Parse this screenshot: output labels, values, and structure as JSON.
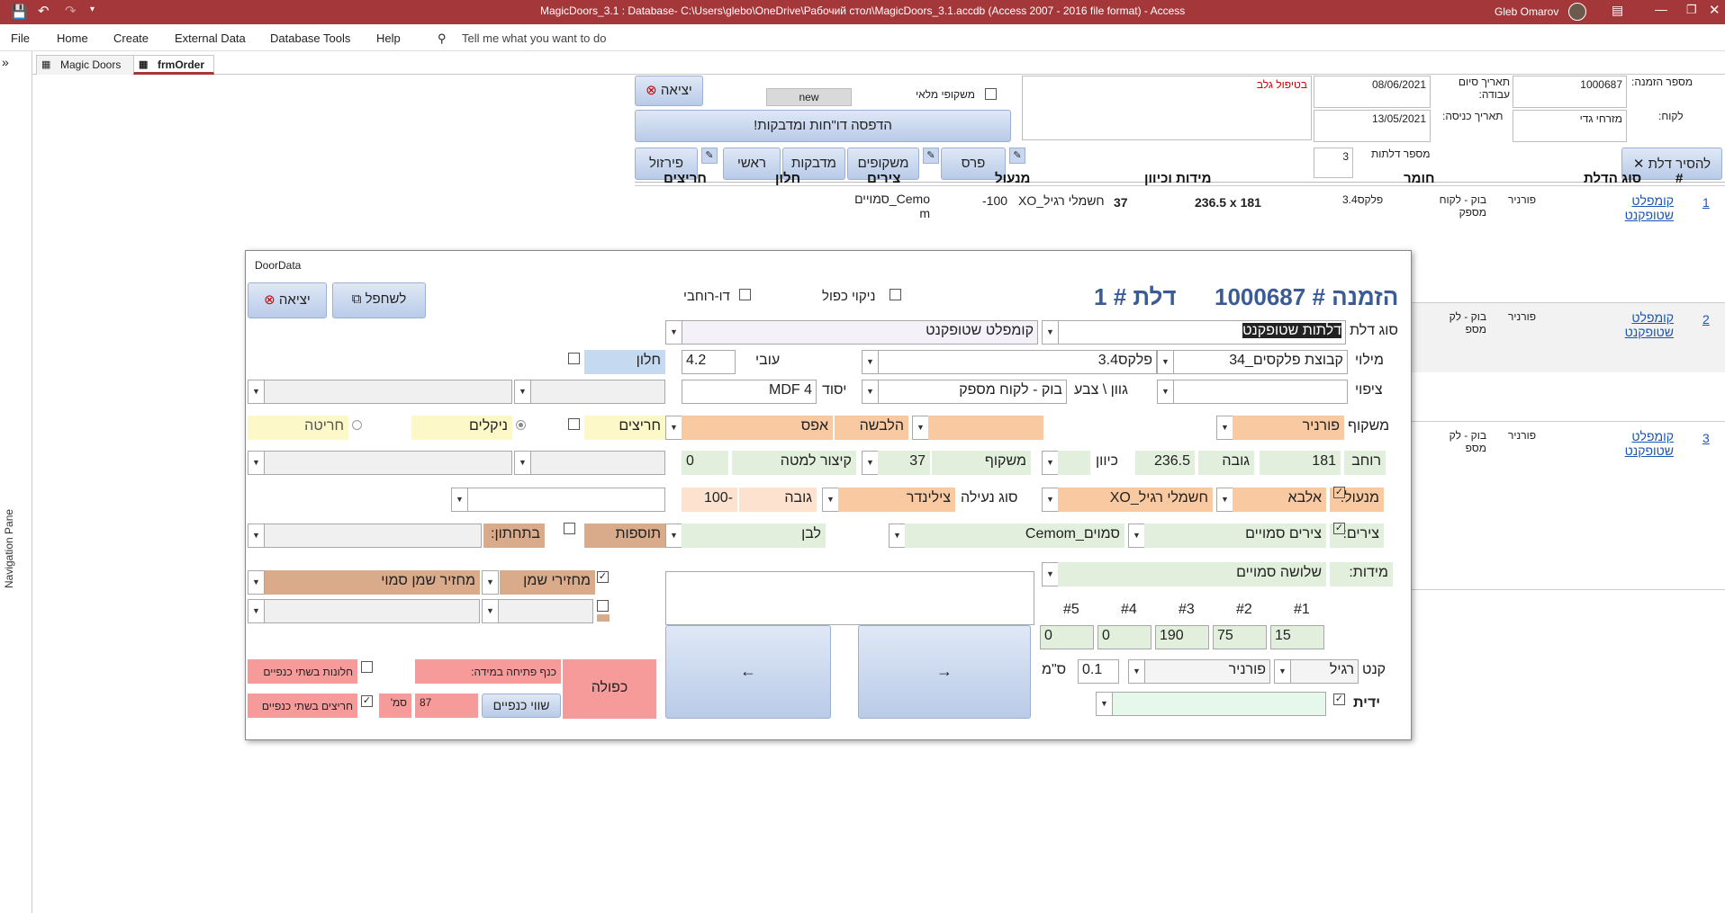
{
  "app": {
    "title": "MagicDoors_3.1 : Database- C:\\Users\\glebo\\OneDrive\\Рабочий стол\\MagicDoors_3.1.accdb (Access 2007 - 2016 file format) - Access",
    "user": "Gleb Omarov"
  },
  "menu": {
    "file": "File",
    "home": "Home",
    "create": "Create",
    "external": "External Data",
    "dbtools": "Database Tools",
    "help": "Help",
    "search": "Tell me what you want to do"
  },
  "tabs": {
    "t1": "Magic Doors",
    "t2": "frmOrder"
  },
  "nav": {
    "label": "Navigation Pane"
  },
  "order": {
    "order_no_label": "מספר הזמנה:",
    "order_no": "1000687",
    "customer_label": "לקוח:",
    "customer": "מזרחי גדי",
    "finish_date_label": "תאריך סיום עבודה:",
    "finish_date": "08/06/2021",
    "entry_date_label": "תאריך כניסה:",
    "entry_date": "13/05/2021",
    "doors_count_label": "מספר דלתות",
    "doors_count": "3",
    "handler": "בטיפול גלב",
    "full_frames_label": "משקופי מלאי",
    "new_label": "new",
    "exit_label": "יציאה",
    "print_label": "הדפסה דו\"חות ומדבקות!",
    "remove_door_label": "להסיר דלת",
    "btn_pars": "פרס",
    "btn_frames": "משקופים",
    "btn_stickers": "מדבקות",
    "btn_main": "ראשי",
    "btn_pirzul": "פירזול",
    "cols": {
      "num": "#",
      "type": "סוג הדלת",
      "material": "חומר",
      "size": "מידות וכיוון",
      "handle": "מנעול",
      "tsirim": "צירים",
      "window": "חלון",
      "grooves": "חריצים"
    },
    "rows": [
      {
        "num": "1",
        "type": "קומפלט שטופקנט",
        "veneer": "פורניר",
        "material": "בוק - לקוח מספק",
        "thick": "פלקס3.4",
        "size": "236.5 x 181",
        "frame": "37",
        "lock": "חשמלי רגיל_XO",
        "lockh": "-100",
        "tsirim": "Cemo_סמויים m"
      },
      {
        "num": "2",
        "type": "קומפלט שטופקנט",
        "veneer": "פורניר",
        "material": "בוק - לק מספ"
      },
      {
        "num": "3",
        "type": "קומפלט שטופקנט",
        "veneer": "פורניר",
        "material": "בוק - לק מספ"
      }
    ]
  },
  "dlg": {
    "title": "DoorData",
    "heading_order_label": "הזמנה #",
    "heading_order": "1000687",
    "heading_door_label": "דלת #",
    "heading_door": "1",
    "exit_label": "יציאה",
    "clone_label": "לשחפל",
    "double_clean_label": "ניקוי כפול",
    "du_rohvi_label": "דו-רוחבי",
    "door_type_label": "סוג דלת",
    "door_type": "דלתות שטופקנט",
    "door_type2": "קומפלט שטופקנט",
    "fill_label": "מילוי",
    "fill1": "קבוצת פלקסים_34",
    "fill2": "פלקס3.4",
    "thickness_label": "עובי",
    "thickness": "4.2",
    "window_label": "חלון",
    "coat_label": "ציפוי",
    "color_label": "גוון \\ צבע",
    "color": "בוק - לקוח מספק",
    "base_label": "יסוד",
    "base": "MDF 4",
    "frame_label": "משקוף",
    "frame": "פורניר",
    "cover_label": "הלבשה",
    "cover": "אפס",
    "grooves_label": "חריצים",
    "nickels_label": "ניקלים",
    "engrave_label": "חריטה",
    "width_label": "רוחב",
    "width": "181",
    "height_label": "גובה",
    "height": "236.5",
    "dir_label": "כיוון",
    "frame2_label": "משקוף",
    "frame2": "37",
    "shorten_label": "קיצור למטה",
    "shorten": "0",
    "lock_label": "מנעול:",
    "lock1": "אלבא",
    "lock2": "חשמלי רגיל_XO",
    "latch_label": "סוג נעילה",
    "latch": "צילינדר",
    "lock_h_label": "גובה",
    "lock_h": "-100",
    "hinges_label": "צירים:",
    "hinges1": "צירים סמויים",
    "hinges2": "סמוים_Cemom",
    "hinges_color": "לבן",
    "extras_label": "תוספות",
    "bottom_label": "בתחתון:",
    "dims_label": "מידות:",
    "dims": "שלושה סמויים",
    "oil_label": "מחזירי שמן",
    "oil_val": "מחזיר שמן סמוי",
    "d1_label": "#1",
    "d2_label": "#2",
    "d3_label": "#3",
    "d4_label": "#4",
    "d5_label": "#5",
    "d1": "15",
    "d2": "75",
    "d3": "190",
    "d4": "0",
    "d5": "0",
    "edge_label": "קנט",
    "edge1": "רגיל",
    "edge2": "פורניר",
    "edge_val": "0.1",
    "edge_unit": "ס\"מ",
    "handle_label": "ידית",
    "double_label": "כפולה",
    "wing_label": "כנף פתיחה במידה:",
    "windows_both_label": "חלונות בשתי כנפיים",
    "grooves_both_label": "חריצים בשתי כנפיים",
    "cm_label": "סמ'",
    "wing_val": "87",
    "equal_label": "שווי כנפיים",
    "prev_label": "←",
    "next_label": "→"
  },
  "colors": {
    "title": "#a4373a",
    "orange": "#f9c9a1",
    "green": "#e2efdc",
    "blue": "#c5d9f1",
    "yellow": "#fdf8c8",
    "pink": "#f79a9a",
    "lightgray": "#ededed",
    "brown": "#d9ab8b"
  }
}
